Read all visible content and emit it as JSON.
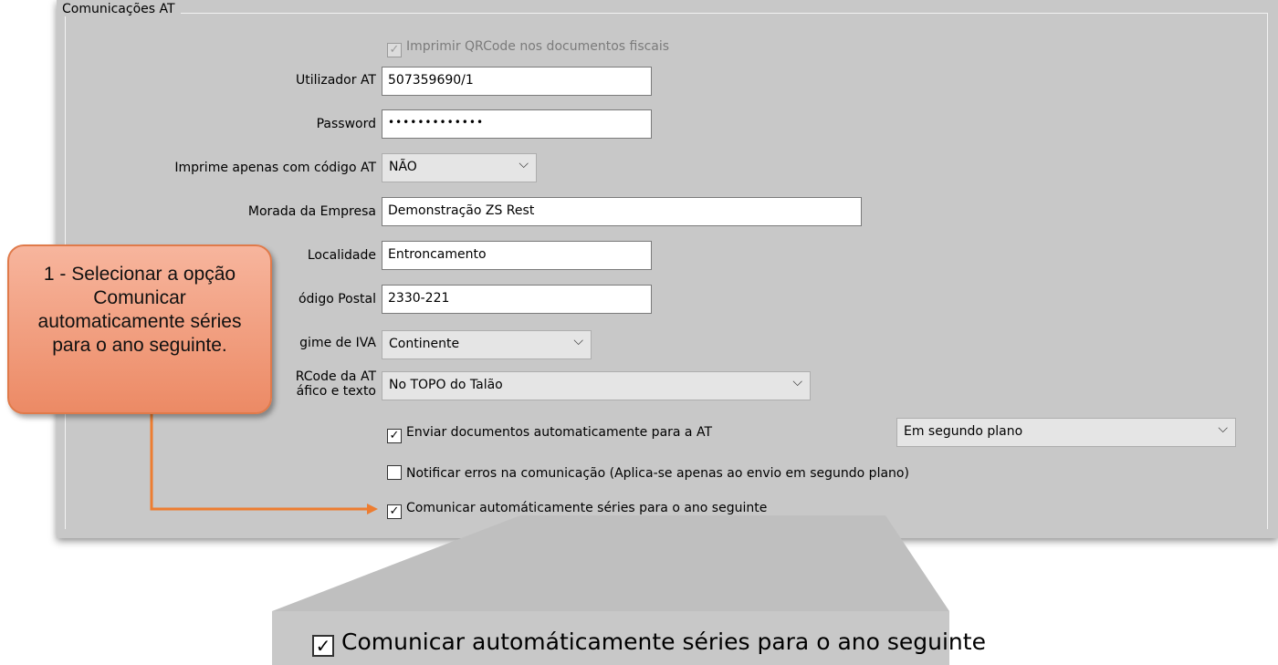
{
  "group": {
    "title": "Comunicações AT"
  },
  "qrcode_checkbox": {
    "label": "Imprimir QRCode nos documentos fiscais",
    "checked": true,
    "enabled": false
  },
  "fields": {
    "utilizador": {
      "label": "Utilizador AT",
      "value": "507359690/1"
    },
    "password": {
      "label": "Password",
      "masked": "•••••••••••••"
    },
    "imprime_codigo": {
      "label": "Imprime apenas com código AT",
      "value": "NÃO"
    },
    "morada": {
      "label": "Morada da Empresa",
      "value": "Demonstração ZS Rest"
    },
    "localidade": {
      "label": "Localidade",
      "value": "Entroncamento"
    },
    "codigo_postal": {
      "label": "ódigo Postal",
      "value": "2330-221"
    },
    "regime_iva": {
      "label": "gime de IVA",
      "value": "Continente"
    },
    "qrcode_at": {
      "label_line1": "RCode da AT",
      "label_line2": "áfico e texto",
      "value": "No TOPO do Talão"
    }
  },
  "checkboxes": {
    "enviar": {
      "label": "Enviar documentos automaticamente para a AT",
      "checked": true
    },
    "enviar_mode": {
      "value": "Em segundo plano"
    },
    "notificar": {
      "label": "Notificar erros na comunicação (Aplica-se apenas ao envio em segundo plano)",
      "checked": false
    },
    "comunicar": {
      "label": "Comunicar automáticamente séries para o ano seguinte",
      "checked": true
    }
  },
  "callout": {
    "text": "1 - Selecionar a opção Comunicar automaticamente séries para o ano seguinte."
  },
  "zoom": {
    "label": "Comunicar automáticamente séries para o ano seguinte",
    "checked": true
  },
  "icons": {
    "check": "✓",
    "chevron": "⌵"
  },
  "colors": {
    "accent_arrow": "#ed7d31",
    "panel_bg": "#c8c8c8",
    "callout_fill": "#f4a380"
  }
}
